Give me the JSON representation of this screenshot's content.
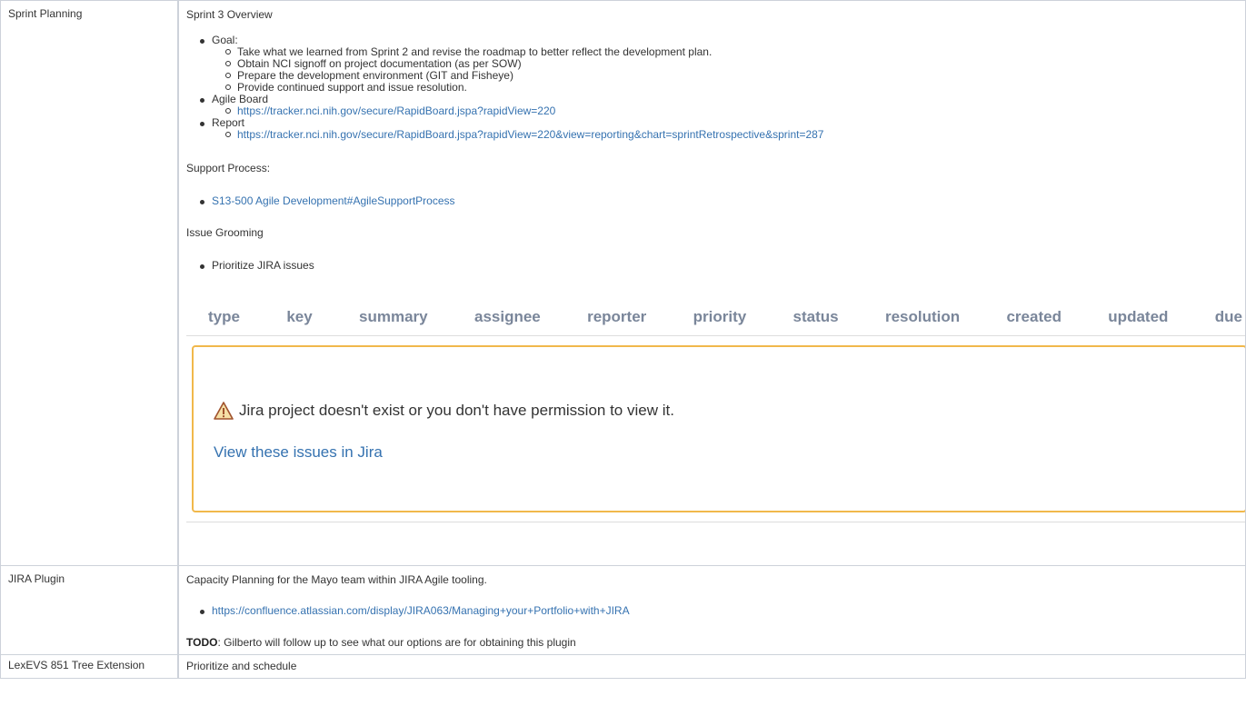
{
  "rows": [
    {
      "label": "Sprint Planning",
      "overview_title": "Sprint 3 Overview",
      "bullets": [
        {
          "text": "Goal:",
          "children": [
            "Take what we learned from Sprint 2 and revise the roadmap to better reflect the development plan.",
            "Obtain NCI signoff on project documentation (as per SOW)",
            "Prepare the development environment (GIT and Fisheye)",
            "Provide continued support and issue resolution."
          ]
        },
        {
          "text": "Agile Board",
          "link": "https://tracker.nci.nih.gov/secure/RapidBoard.jspa?rapidView=220"
        },
        {
          "text": "Report",
          "link": "https://tracker.nci.nih.gov/secure/RapidBoard.jspa?rapidView=220&view=reporting&chart=sprintRetrospective&sprint=287"
        }
      ],
      "support_title": "Support Process:",
      "support_link": "S13-500 Agile Development#AgileSupportProcess",
      "grooming_title": "Issue Grooming",
      "grooming_item": "Prioritize JIRA issues",
      "jira_columns": [
        "type",
        "key",
        "summary",
        "assignee",
        "reporter",
        "priority",
        "status",
        "resolution",
        "created",
        "updated",
        "due"
      ],
      "jira_message": "Jira project doesn't exist or you don't have permission to view it.",
      "jira_link": "View these issues in Jira",
      "warning_icon": "warning-triangle-icon"
    },
    {
      "label": "JIRA Plugin",
      "description": "Capacity Planning for the Mayo team within JIRA Agile tooling.",
      "link": "https://confluence.atlassian.com/display/JIRA063/Managing+your+Portfolio+with+JIRA",
      "todo_label": "TODO",
      "todo_text": ": Gilberto will follow up to see what our options are for obtaining this plugin"
    },
    {
      "label": "LexEVS 851 Tree Extension",
      "description": "Prioritize and schedule"
    }
  ],
  "colors": {
    "link": "#3572b0",
    "warning_border": "#f1b84b",
    "border": "#cdd2da"
  }
}
